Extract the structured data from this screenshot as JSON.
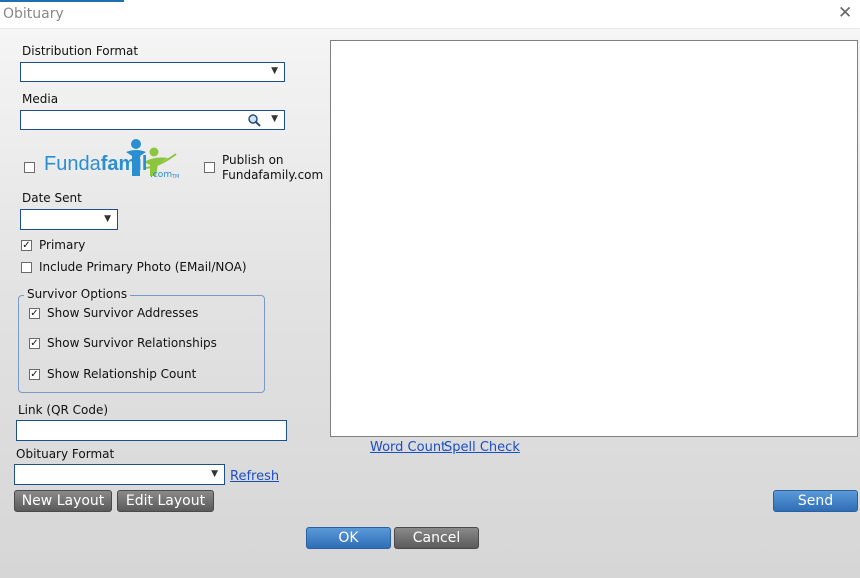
{
  "window": {
    "title": "Obituary"
  },
  "distribution_format": {
    "label": "Distribution Format",
    "value": ""
  },
  "media": {
    "label": "Media",
    "value": ""
  },
  "fundafamily": {
    "logo_part1": "Funda",
    "logo_part2": "famil",
    "logo_suffix": ".com",
    "logo_tm": "TM",
    "publish_label": "Publish on Fundafamily.com",
    "publish_checked": false,
    "logo_checkbox_checked": false
  },
  "date_sent": {
    "label": "Date Sent",
    "value": ""
  },
  "primary": {
    "label": "Primary",
    "checked": true
  },
  "include_photo": {
    "label": "Include Primary Photo (EMail/NOA)",
    "checked": false
  },
  "survivor_options": {
    "title": "Survivor Options",
    "items": [
      {
        "label": "Show Survivor Addresses",
        "checked": true
      },
      {
        "label": "Show Survivor Relationships",
        "checked": true
      },
      {
        "label": "Show Relationship Count",
        "checked": true
      }
    ]
  },
  "link_qr": {
    "label": "Link (QR Code)",
    "value": ""
  },
  "obituary_format": {
    "label": "Obituary Format",
    "value": "",
    "refresh_label": "Refresh"
  },
  "buttons": {
    "new_layout": "New Layout",
    "edit_layout": "Edit Layout",
    "send": "Send",
    "ok": "OK",
    "cancel": "Cancel"
  },
  "editor": {
    "word_count": "Word Count",
    "spell_check": "Spell Check"
  },
  "colors": {
    "accent_blue": "#2f6db6",
    "link": "#1a4fc4",
    "logo_blue": "#2a8fd0",
    "logo_green": "#8cc63f"
  },
  "icons": {
    "dropdown": "chevron-down-icon",
    "search": "magnifier-icon",
    "close": "close-icon",
    "check": "check-icon"
  }
}
